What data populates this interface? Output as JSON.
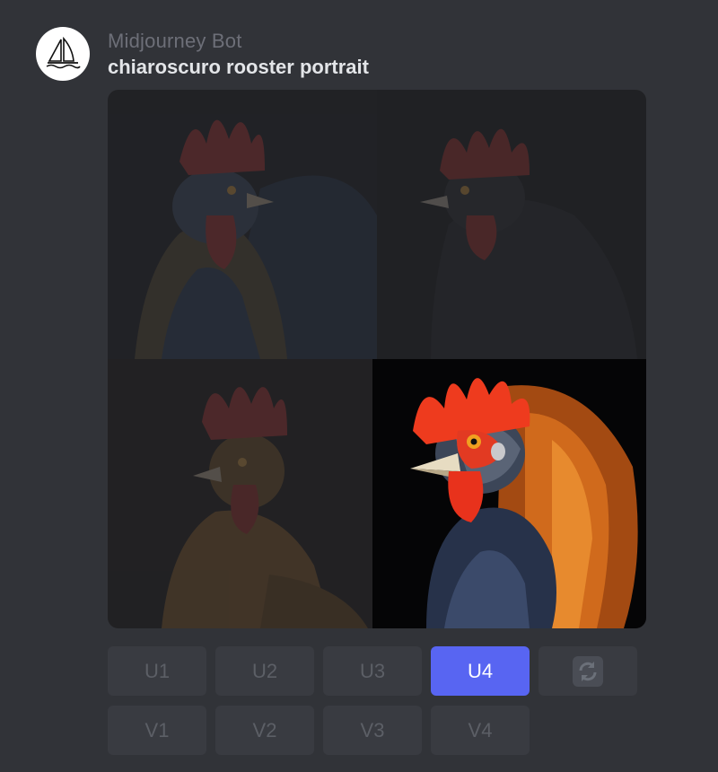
{
  "message": {
    "author": "Midjourney Bot",
    "prompt": "chiaroscuro rooster portrait"
  },
  "images": [
    {
      "name": "rooster-image-1",
      "selected": false
    },
    {
      "name": "rooster-image-2",
      "selected": false
    },
    {
      "name": "rooster-image-3",
      "selected": false
    },
    {
      "name": "rooster-image-4",
      "selected": true
    }
  ],
  "buttons": {
    "upscale": [
      "U1",
      "U2",
      "U3",
      "U4"
    ],
    "variation": [
      "V1",
      "V2",
      "V3",
      "V4"
    ],
    "active": "U4",
    "reroll_icon": "refresh-icon"
  },
  "colors": {
    "background": "#313338",
    "button": "#393b41",
    "button_active": "#5865f2",
    "author_text": "#6d6f78",
    "prompt_text": "#e3e5e8"
  }
}
